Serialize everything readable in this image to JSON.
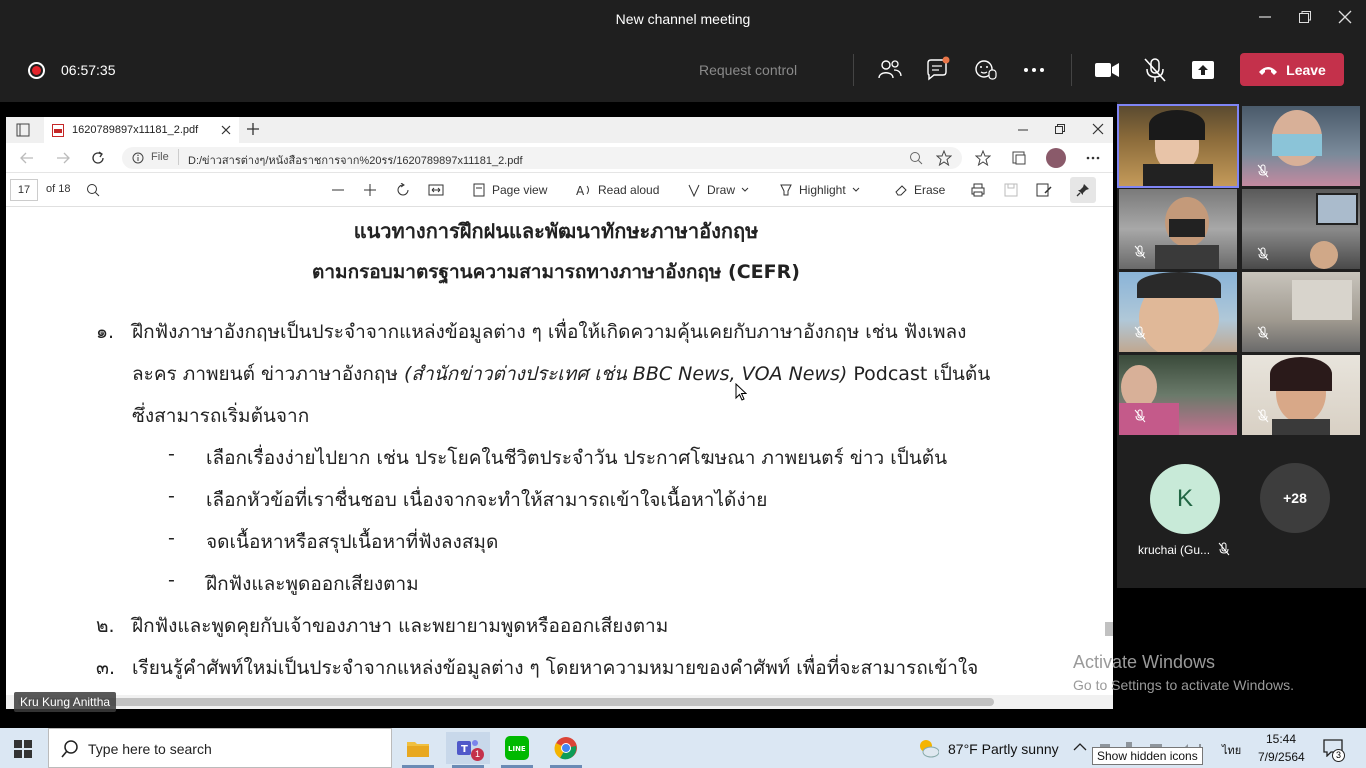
{
  "window": {
    "title": "New channel meeting"
  },
  "meeting": {
    "timer": "06:57:35",
    "request_control": "Request control",
    "leave_label": "Leave"
  },
  "browser": {
    "tab_title": "1620789897x11181_2.pdf",
    "file_label": "File",
    "url": "D:/ข่าวสารต่างๆ/หนังสือราชการจาก%20รร/1620789897x11181_2.pdf",
    "page_number": "17",
    "page_total": "of 18",
    "toolbar": {
      "page_view": "Page view",
      "read_aloud": "Read aloud",
      "draw": "Draw",
      "highlight": "Highlight",
      "erase": "Erase"
    }
  },
  "document": {
    "heading1": "แนวทางการฝึกฝนและพัฒนาทักษะภาษาอังกฤษ",
    "heading2": "ตามกรอบมาตรฐานความสามารถทางภาษาอังกฤษ (CEFR)",
    "item1_num": "๑.",
    "item1_line1": "ฝึกฟังภาษาอังกฤษเป็นประจำจากแหล่งข้อมูลต่าง ๆ เพื่อให้เกิดความคุ้นเคยกับภาษาอังกฤษ เช่น ฟังเพลง",
    "item1_line2_a": "ละคร ภาพยนต์ ข่าวภาษาอังกฤษ",
    "item1_line2_italic": "(สำนักข่าวต่างประเทศ เช่น BBC News, VOA News)",
    "item1_line2_b": "Podcast เป็นต้น",
    "item1_line3": "ซึ่งสามารถเริ่มต้นจาก",
    "bullets": [
      "เลือกเรื่องง่ายไปยาก เช่น ประโยคในชีวิตประจำวัน ประกาศโฆษณา ภาพยนตร์ ข่าว เป็นต้น",
      "เลือกหัวข้อที่เราชื่นชอบ เนื่องจากจะทำให้สามารถเข้าใจเนื้อหาได้ง่าย",
      "จดเนื้อหาหรือสรุปเนื้อหาที่ฟังลงสมุด",
      "ฝึกฟังและพูดออกเสียงตาม"
    ],
    "bullet_mark": "-",
    "item2_num": "๒.",
    "item2": "ฝึกฟังและพูดคุยกับเจ้าของภาษา และพยายามพูดหรือออกเสียงตาม",
    "item3_num": "๓.",
    "item3": "เรียนรู้คำศัพท์ใหม่เป็นประจำจากแหล่งข้อมูลต่าง ๆ โดยหาความหมายของคำศัพท์ เพื่อที่จะสามารถเข้าใจ"
  },
  "presenter_name": "Kru Kung Anittha",
  "participants": {
    "k_initial": "K",
    "k_name": "kruchai (Gu...",
    "more_count": "+28"
  },
  "activation": {
    "line1": "Activate Windows",
    "line2": "Go to Settings to activate Windows."
  },
  "taskbar": {
    "search_placeholder": "Type here to search",
    "weather": "87°F  Partly sunny",
    "language": "ไทย",
    "time": "15:44",
    "date": "7/9/2564",
    "notifications": "3",
    "tooltip": "Show hidden icons",
    "teams_badge": "1"
  }
}
